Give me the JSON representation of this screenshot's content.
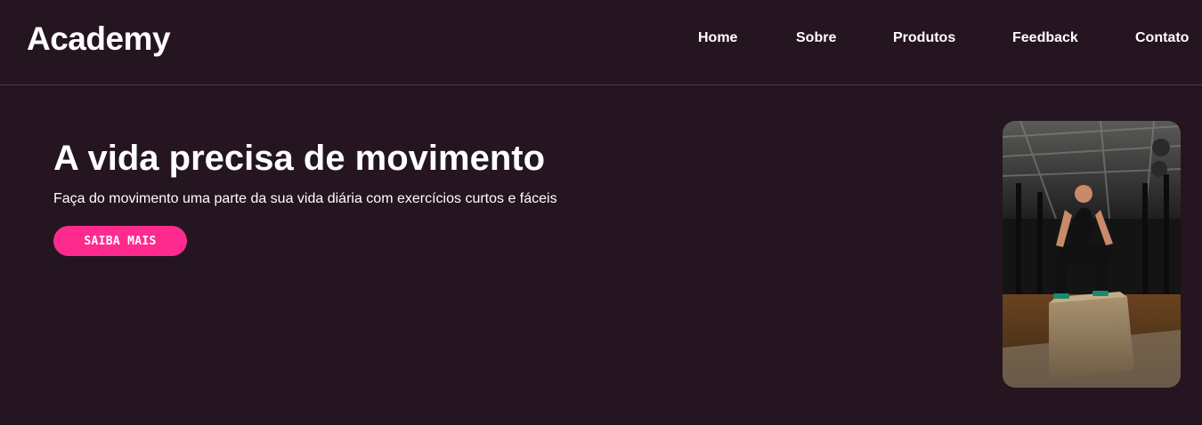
{
  "brand": {
    "name": "Academy"
  },
  "nav": {
    "items": [
      {
        "label": "Home"
      },
      {
        "label": "Sobre"
      },
      {
        "label": "Produtos"
      },
      {
        "label": "Feedback"
      },
      {
        "label": "Contato"
      }
    ]
  },
  "hero": {
    "title": "A vida precisa de movimento",
    "subtitle": "Faça do movimento uma parte da sua vida diária com exercícios curtos e fáceis",
    "cta_label": "SAIBA MAIS",
    "image": "gym-athlete-box-photo"
  },
  "colors": {
    "background": "#251520",
    "accent": "#ff2a8e",
    "text": "#ffffff",
    "divider": "#4a3a45"
  }
}
